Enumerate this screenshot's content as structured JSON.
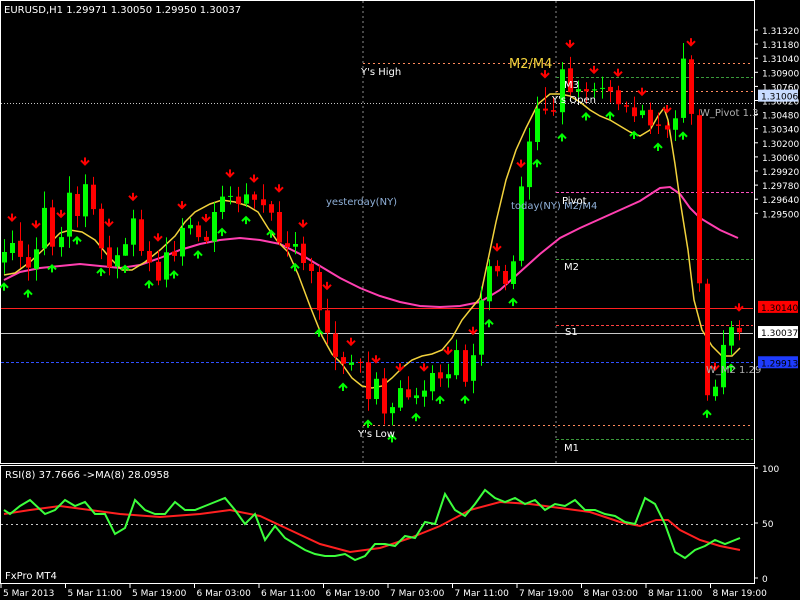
{
  "chart_header": "EURUSD,H1  1.29971 1.30050 1.29950 1.30037",
  "rsi_header": "RSI(8) 37.7666   ->MA(8) 28.0958",
  "broker_label": "FxPro MT4",
  "colors": {
    "background": "#000000",
    "bull": "#00ff00",
    "bear": "#ff0000",
    "ma_fast": "#ffd700",
    "ma_slow": "#ff3fb0",
    "rsi_line": "#3cff3c",
    "rsi_ma": "#ff2020",
    "axis": "#ffffff"
  },
  "labels": {
    "ys_high": "Y's High",
    "ys_low": "Y's Low",
    "ys_open": "Y's Open",
    "yesterday": "yesterday(NY)",
    "today": "today(NY) M2/M4",
    "m2m4": "M2/M4",
    "m3": "M3",
    "pivot": "Pivot",
    "m2": "M2",
    "s1": "S1",
    "m1": "M1",
    "w_pivot": "W_Pivot 1.3",
    "w_m2": "W_M2 1.29"
  },
  "price_axis": {
    "ticks": [
      "1.31320",
      "1.31180",
      "1.31040",
      "1.30900",
      "1.30760",
      "1.30620",
      "1.30480",
      "1.30340",
      "1.30200",
      "1.30060",
      "1.29920",
      "1.29780",
      "1.29640",
      "1.29500"
    ],
    "badges": [
      {
        "text": "1.31006",
        "bg": "#c8dcff",
        "fg": "#000000"
      },
      {
        "text": "1.30140",
        "bg": "#ff0000",
        "fg": "#000000"
      },
      {
        "text": "1.30037",
        "bg": "#ffffff",
        "fg": "#000000"
      },
      {
        "text": "1.29913",
        "bg": "#1e3cff",
        "fg": "#000000"
      }
    ]
  },
  "rsi_axis": {
    "ticks": [
      "100",
      "50",
      "0"
    ]
  },
  "time_axis": {
    "ticks": [
      "5 Mar 2013",
      "5 Mar 11:00",
      "5 Mar 19:00",
      "6 Mar 03:00",
      "6 Mar 11:00",
      "6 Mar 19:00",
      "7 Mar 03:00",
      "7 Mar 11:00",
      "7 Mar 19:00",
      "8 Mar 03:00",
      "8 Mar 11:00",
      "8 Mar 19:00"
    ]
  },
  "chart_data": {
    "type": "candlestick",
    "symbol": "EURUSD",
    "timeframe": "H1",
    "ylim": [
      1.295,
      1.3139
    ],
    "levels": {
      "ys_high": 1.3116,
      "ys_open": 1.31024,
      "ys_low": 1.29632,
      "m3": 1.31106,
      "pivot": 1.30652,
      "m2": 1.30364,
      "s1": 1.30072,
      "m1": 1.29566,
      "current": 1.30037,
      "w_pivot": 1.31006,
      "w_m2": 1.29913,
      "red_line": 1.3014
    },
    "candles": [
      [
        1.30322,
        1.30365,
        1.30418,
        1.30276
      ],
      [
        1.30361,
        1.30402,
        1.30453,
        1.30331
      ],
      [
        1.30411,
        1.30345,
        1.30487,
        1.30299
      ],
      [
        1.30344,
        1.30301,
        1.30396,
        1.30248
      ],
      [
        1.30296,
        1.30376,
        1.30425,
        1.30248
      ],
      [
        1.3038,
        1.30546,
        1.30613,
        1.30352
      ],
      [
        1.30548,
        1.30387,
        1.30579,
        1.30351
      ],
      [
        1.30385,
        1.30426,
        1.30468,
        1.30346
      ],
      [
        1.30428,
        1.30608,
        1.30676,
        1.30382
      ],
      [
        1.30603,
        1.30513,
        1.30634,
        1.30466
      ],
      [
        1.30511,
        1.30643,
        1.30683,
        1.30467
      ],
      [
        1.30641,
        1.30541,
        1.30673,
        1.30518
      ],
      [
        1.30542,
        1.3038,
        1.30564,
        1.30336
      ],
      [
        1.30384,
        1.30303,
        1.30432,
        1.30269
      ],
      [
        1.30306,
        1.30352,
        1.30384,
        1.30257
      ],
      [
        1.3035,
        1.30397,
        1.30423,
        1.30349
      ],
      [
        1.30395,
        1.30503,
        1.30538,
        1.30348
      ],
      [
        1.30499,
        1.30369,
        1.30538,
        1.3035
      ],
      [
        1.30369,
        1.30322,
        1.30409,
        1.30286
      ],
      [
        1.30325,
        1.30248,
        1.30372,
        1.30229
      ],
      [
        1.30252,
        1.30364,
        1.30425,
        1.3022
      ],
      [
        1.30367,
        1.30349,
        1.3041,
        1.30326
      ],
      [
        1.30347,
        1.30464,
        1.30504,
        1.30309
      ],
      [
        1.30462,
        1.30476,
        1.30505,
        1.30437
      ],
      [
        1.30474,
        1.30426,
        1.3049,
        1.30408
      ],
      [
        1.30427,
        1.30411,
        1.30451,
        1.30398
      ],
      [
        1.30408,
        1.30529,
        1.30569,
        1.30365
      ],
      [
        1.30529,
        1.30592,
        1.30637,
        1.305
      ],
      [
        1.30593,
        1.30595,
        1.30634,
        1.3056
      ],
      [
        1.30592,
        1.30562,
        1.30632,
        1.30528
      ],
      [
        1.30563,
        1.30601,
        1.30647,
        1.30549
      ],
      [
        1.30601,
        1.30579,
        1.30613,
        1.30542
      ],
      [
        1.30581,
        1.30557,
        1.30643,
        1.30526
      ],
      [
        1.30561,
        1.30526,
        1.30574,
        1.30493
      ],
      [
        1.30529,
        1.30404,
        1.30573,
        1.30392
      ],
      [
        1.30401,
        1.30386,
        1.3045,
        1.30346
      ],
      [
        1.30387,
        1.30398,
        1.30447,
        1.30356
      ],
      [
        1.30399,
        1.3032,
        1.30428,
        1.30291
      ],
      [
        1.30317,
        1.30287,
        1.30341,
        1.30237
      ],
      [
        1.30283,
        1.30126,
        1.30311,
        1.30087
      ],
      [
        1.30126,
        1.30034,
        1.30173,
        1.29988
      ],
      [
        1.30031,
        1.29935,
        1.30081,
        1.29881
      ],
      [
        1.29934,
        1.29907,
        1.29956,
        1.29865
      ],
      [
        1.29902,
        1.29912,
        1.29944,
        1.29879
      ],
      [
        1.29914,
        1.29912,
        1.29929,
        1.2987
      ],
      [
        1.29913,
        1.29762,
        1.29957,
        1.29714
      ],
      [
        1.29762,
        1.29845,
        1.29872,
        1.2974
      ],
      [
        1.29847,
        1.29703,
        1.29889,
        1.29658
      ],
      [
        1.29704,
        1.29729,
        1.29747,
        1.29654
      ],
      [
        1.29727,
        1.29807,
        1.29839,
        1.29713
      ],
      [
        1.29802,
        1.29769,
        1.29856,
        1.2976
      ],
      [
        1.29766,
        1.29777,
        1.29808,
        1.29741
      ],
      [
        1.29772,
        1.29797,
        1.29839,
        1.29731
      ],
      [
        1.29794,
        1.29869,
        1.29901,
        1.29757
      ],
      [
        1.29872,
        1.29847,
        1.29904,
        1.29812
      ],
      [
        1.29847,
        1.29864,
        1.29907,
        1.29809
      ],
      [
        1.2986,
        1.29963,
        1.30006,
        1.29843
      ],
      [
        1.29963,
        1.29833,
        1.29986,
        1.29813
      ],
      [
        1.29837,
        1.29942,
        1.29989,
        1.29786
      ],
      [
        1.29944,
        1.30167,
        1.30223,
        1.29899
      ],
      [
        1.30163,
        1.30307,
        1.30335,
        1.30126
      ],
      [
        1.30308,
        1.30286,
        1.30331,
        1.30265
      ],
      [
        1.30287,
        1.30234,
        1.30312,
        1.30208
      ],
      [
        1.30234,
        1.30327,
        1.30351,
        1.30213
      ],
      [
        1.30329,
        1.30634,
        1.30674,
        1.30306
      ],
      [
        1.30631,
        1.30818,
        1.30874,
        1.3058
      ],
      [
        1.30816,
        1.30953,
        1.31002,
        1.30782
      ],
      [
        1.30953,
        1.30945,
        1.31041,
        1.30929
      ],
      [
        1.30947,
        1.3094,
        1.31001,
        1.30923
      ],
      [
        1.30938,
        1.31114,
        1.31144,
        1.30888
      ],
      [
        1.31118,
        1.3102,
        1.31165,
        1.31008
      ],
      [
        1.31023,
        1.31033,
        1.31068,
        1.31
      ],
      [
        1.31033,
        1.31024,
        1.31061,
        1.30974
      ],
      [
        1.31027,
        1.31032,
        1.31059,
        1.30997
      ],
      [
        1.31035,
        1.31038,
        1.31084,
        1.30994
      ],
      [
        1.31042,
        1.31024,
        1.3107,
        1.30978
      ],
      [
        1.31028,
        1.30971,
        1.31047,
        1.30947
      ],
      [
        1.30967,
        1.30961,
        1.30982,
        1.30937
      ],
      [
        1.30958,
        1.30922,
        1.31002,
        1.30898
      ],
      [
        1.30926,
        1.30945,
        1.30969,
        1.30914
      ],
      [
        1.30948,
        1.30884,
        1.30978,
        1.30849
      ],
      [
        1.30888,
        1.30882,
        1.30937,
        1.30849
      ],
      [
        1.30884,
        1.30867,
        1.30898,
        1.30833
      ],
      [
        1.30866,
        1.30913,
        1.30946,
        1.3082
      ],
      [
        1.30915,
        1.31158,
        1.31222,
        1.30895
      ],
      [
        1.31155,
        1.30931,
        1.31172,
        1.30887
      ],
      [
        1.30926,
        1.30237,
        1.3095,
        1.30202
      ],
      [
        1.30235,
        1.29778,
        1.30255,
        1.29755
      ],
      [
        1.29774,
        1.29813,
        1.29842,
        1.29755
      ],
      [
        1.2981,
        1.29984,
        1.30045,
        1.29782
      ],
      [
        1.29981,
        1.30057,
        1.30082,
        1.29943
      ],
      [
        1.30054,
        1.30036,
        1.30085,
        1.30003
      ]
    ],
    "ma_fast_label": "M2/M4",
    "rsi": {
      "period": 8,
      "value": 37.7666,
      "ma_period": 8,
      "ma_value": 28.0958,
      "ylim": [
        0,
        100
      ],
      "level": 50
    }
  }
}
